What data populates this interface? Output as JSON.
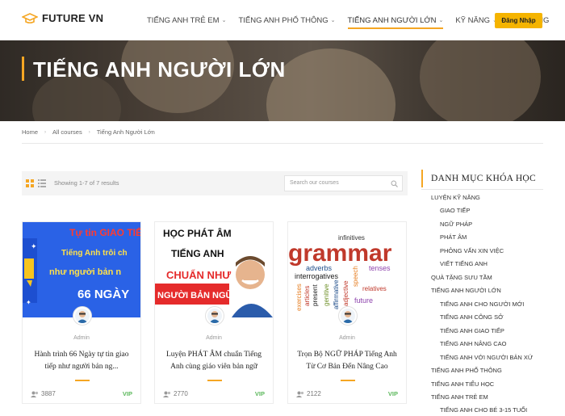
{
  "brand": {
    "logo_text": "FUTURE VN",
    "accent": "#f5a623",
    "button_color": "#f5b400"
  },
  "nav": {
    "items": [
      {
        "label": "TIẾNG ANH TRẺ EM",
        "has_dropdown": true
      },
      {
        "label": "TIẾNG ANH PHỔ THÔNG",
        "has_dropdown": true
      },
      {
        "label": "TIẾNG ANH NGƯỜI LỚN",
        "has_dropdown": true,
        "active": true
      },
      {
        "label": "KỸ NĂNG",
        "has_dropdown": true
      },
      {
        "label": "QUÀ TẶNG",
        "has_dropdown": false
      }
    ],
    "login_label": "Đăng Nhập"
  },
  "hero": {
    "title": "TIẾNG ANH NGƯỜI LỚN"
  },
  "breadcrumb": [
    "Home",
    "All courses",
    "Tiếng Anh Người Lớn"
  ],
  "toolbar": {
    "showing": "Showing 1-7 of 7 results",
    "search_placeholder": "Search our courses"
  },
  "courses": [
    {
      "image_text": [
        "Tự tin GIAO TIẾ",
        "Tiếng Anh trôi ch",
        "như người bản n",
        "66 NGÀY"
      ],
      "author": "Admin",
      "title": "Hành trình 66 Ngày tự tin giao tiếp như người bản ng...",
      "students": "3887",
      "badge": "VIP"
    },
    {
      "image_text": [
        "HỌC PHÁT ÂM",
        "TIẾNG ANH",
        "CHUẨN NHƯ",
        "NGƯỜI BẢN NGỮ"
      ],
      "author": "Admin",
      "title": "Luyện PHÁT ÂM chuẩn Tiếng Anh cùng giáo viên bản ngữ",
      "students": "2770",
      "badge": "VIP"
    },
    {
      "image_text": [
        "infinitives",
        "grammar",
        "adverbs",
        "tenses",
        "interrogatives",
        "relatives",
        "future",
        "present",
        "articles",
        "exercises",
        "genitive",
        "affirmative",
        "adjective",
        "speech"
      ],
      "author": "Admin",
      "title": "Trọn Bộ NGỮ PHÁP Tiếng Anh Từ Cơ Bản Đến Nâng Cao",
      "students": "2122",
      "badge": "VIP"
    }
  ],
  "sidebar": {
    "title": "DANH MỤC KHÓA HỌC",
    "items": [
      {
        "label": "LUYỆN KỸ NĂNG",
        "level": 0
      },
      {
        "label": "GIAO TIẾP",
        "level": 1
      },
      {
        "label": "NGỮ PHÁP",
        "level": 1
      },
      {
        "label": "PHÁT ÂM",
        "level": 1
      },
      {
        "label": "PHỎNG VẤN XIN VIỆC",
        "level": 1
      },
      {
        "label": "VIẾT TIẾNG ANH",
        "level": 1
      },
      {
        "label": "QUÀ TẶNG SƯU TẦM",
        "level": 0
      },
      {
        "label": "TIẾNG ANH NGƯỜI LỚN",
        "level": 0
      },
      {
        "label": "TIẾNG ANH CHO NGƯỜI MỚI",
        "level": 1
      },
      {
        "label": "TIẾNG ANH CÔNG SỞ",
        "level": 1
      },
      {
        "label": "TIẾNG ANH GIAO TIẾP",
        "level": 1
      },
      {
        "label": "TIẾNG ANH NÂNG CAO",
        "level": 1
      },
      {
        "label": "TIẾNG ANH VỚI NGƯỜI BẢN XỨ",
        "level": 1
      },
      {
        "label": "TIẾNG ANH PHỔ THÔNG",
        "level": 0
      },
      {
        "label": "TIẾNG ANH TIỂU HỌC",
        "level": 0
      },
      {
        "label": "TIẾNG ANH TRẺ EM",
        "level": 0
      },
      {
        "label": "TIẾNG ANH CHO BÉ 3-15 TUỔI",
        "level": 1
      }
    ]
  }
}
